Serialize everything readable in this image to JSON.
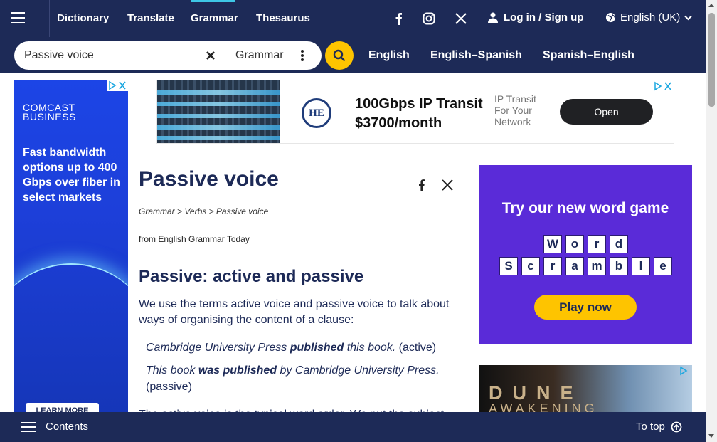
{
  "topnav": {
    "links": [
      "Dictionary",
      "Translate",
      "Grammar",
      "Thesaurus"
    ],
    "active": "Grammar",
    "login": "Log in / Sign up",
    "language": "English (UK)",
    "social_icons": [
      "facebook-icon",
      "instagram-icon",
      "x-icon"
    ]
  },
  "search": {
    "value": "Passive voice",
    "dictionary": "Grammar",
    "dict_links": [
      "English",
      "English–Spanish",
      "Spanish–English"
    ]
  },
  "left_ad": {
    "brand_line1": "COMCAST",
    "brand_line2": "BUSINESS",
    "copy": "Fast bandwidth options up to 400 Gbps over fiber in select markets",
    "cta": "LEARN MORE"
  },
  "banner_ad": {
    "logo": "HE",
    "title_line1": "100Gbps IP Transit",
    "title_line2": "$3700/month",
    "sub_line1": "IP Transit",
    "sub_line2": "For Your",
    "sub_line3": "Network",
    "button": "Open"
  },
  "article": {
    "title": "Passive voice",
    "breadcrumb": "Grammar > Verbs > Passive voice",
    "from_prefix": "from",
    "from_link": "English Grammar Today",
    "heading": "Passive: active and passive",
    "paragraph": "We use the terms active voice and passive voice to talk about ways of organising the content of a clause:",
    "example1": {
      "pre": "Cambridge University Press ",
      "bold": "published",
      "post": " this book.",
      "tag": " (active)"
    },
    "example2": {
      "pre": "This book ",
      "bold": "was published",
      "post": " by Cambridge University Press.",
      "tag": " (passive)"
    },
    "cut_text": "The active voice is the typical word order. We put the subject..."
  },
  "game_ad": {
    "title": "Try our new word game",
    "row1": [
      "W",
      "o",
      "r",
      "d"
    ],
    "row2": [
      "S",
      "c",
      "r",
      "a",
      "m",
      "b",
      "l",
      "e"
    ],
    "button": "Play now"
  },
  "dune_ad": {
    "title": "DUNE",
    "subtitle": "AWAKENING"
  },
  "bottombar": {
    "contents": "Contents",
    "totop": "To top"
  },
  "colors": {
    "navy": "#1d2a57",
    "accent_yellow": "#fec400",
    "game_purple": "#5a2bd8"
  }
}
